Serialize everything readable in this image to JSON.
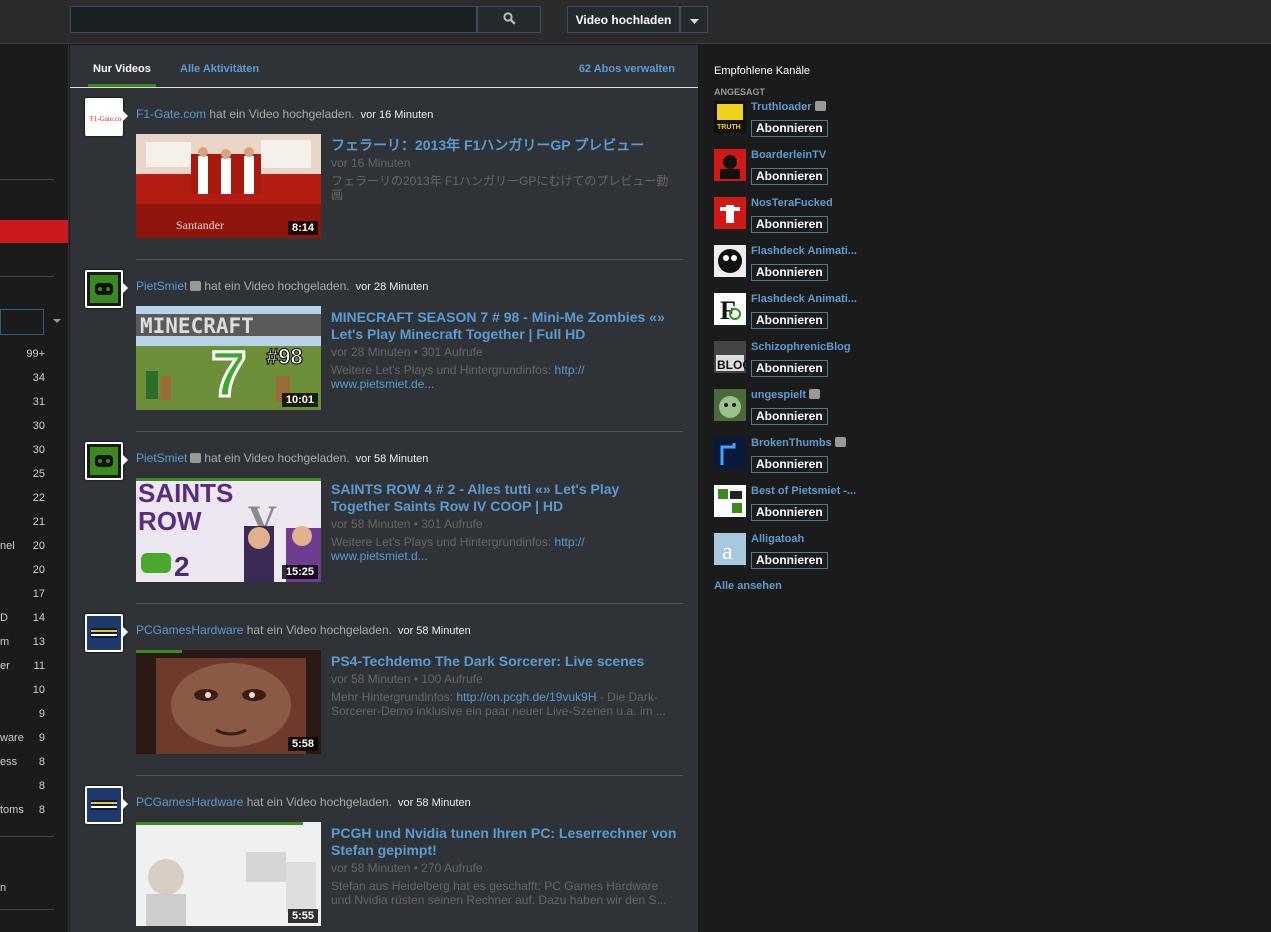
{
  "topbar": {
    "search_placeholder": "",
    "upload_label": "Video hochladen"
  },
  "sidebar": {
    "rows": [
      {
        "label": "",
        "count": "99+"
      },
      {
        "label": "",
        "count": "34"
      },
      {
        "label": "",
        "count": "31"
      },
      {
        "label": "",
        "count": "30"
      },
      {
        "label": "",
        "count": "30"
      },
      {
        "label": "",
        "count": "25"
      },
      {
        "label": "",
        "count": "22"
      },
      {
        "label": "",
        "count": "21"
      },
      {
        "label": "nel",
        "count": "20"
      },
      {
        "label": "",
        "count": "20"
      },
      {
        "label": "",
        "count": "17"
      },
      {
        "label": "D",
        "count": "14"
      },
      {
        "label": "m",
        "count": "13"
      },
      {
        "label": "er",
        "count": "11"
      },
      {
        "label": "",
        "count": "10"
      },
      {
        "label": "",
        "count": "9"
      },
      {
        "label": "ware",
        "count": "9"
      },
      {
        "label": "ess",
        "count": "8"
      },
      {
        "label": "",
        "count": "8"
      },
      {
        "label": "toms",
        "count": "8"
      }
    ],
    "bottom_text": "n"
  },
  "tabs": {
    "videos": "Nur Videos",
    "all": "Alle Aktivitäten",
    "manage": "62 Abos verwalten"
  },
  "feed": [
    {
      "channel": "F1-Gate.com",
      "verified": false,
      "action": "hat ein Video hochgeladen.",
      "ago": "vor 16 Minuten",
      "title": "フェラーリ：2013年 F1ハンガリーGP プレビュー",
      "meta": "vor 16 Minuten",
      "desc": "フェラーリの2013年 F1ハンガリーGPにむけてのプレビュー動画",
      "desc_link": "",
      "duration": "8:14"
    },
    {
      "channel": "PietSmiet",
      "verified": true,
      "action": "hat ein Video hochgeladen.",
      "ago": "vor 28 Minuten",
      "title": "MINECRAFT SEASON 7 # 98 - Mini-Me Zombies «» Let's Play Minecraft Together | Full HD",
      "meta": "vor 28 Minuten  •  301 Aufrufe",
      "desc": "Weitere Let's Plays und Hintergrundinfos: ",
      "desc_link": "http:// www.pietsmiet.de...",
      "duration": "10:01"
    },
    {
      "channel": "PietSmiet",
      "verified": true,
      "action": "hat ein Video hochgeladen.",
      "ago": "vor 58 Minuten",
      "title": "SAINTS ROW 4 # 2 - Alles tutti «» Let's Play Together Saints Row IV COOP | HD",
      "meta": "vor 58 Minuten  •  301 Aufrufe",
      "desc": "Weitere Let's Plays und Hintergrundinfos: ",
      "desc_link": "http:// www.pietsmiet.d...",
      "duration": "15:25"
    },
    {
      "channel": "PCGamesHardware",
      "verified": false,
      "action": "hat ein Video hochgeladen.",
      "ago": "vor 58 Minuten",
      "title": "PS4-Techdemo The Dark Sorcerer: Live scenes",
      "meta": "vor 58 Minuten  •  100 Aufrufe",
      "desc": "Mehr Hintergrundinfos: ",
      "desc_link": "http://on.pcgh.de/19vuk9H",
      "desc_after": " - Die Dark-Sorcerer-Demo inklusive ein paar neuer Live-Szenen u.a. im ...",
      "duration": "5:58"
    },
    {
      "channel": "PCGamesHardware",
      "verified": false,
      "action": "hat ein Video hochgeladen.",
      "ago": "vor 58 Minuten",
      "title": "PCGH und Nvidia tunen Ihren PC: Leserrechner von Stefan gepimpt!",
      "meta": "vor 58 Minuten  •  270 Aufrufe",
      "desc": "Stefan aus Heidelberg hat es geschafft: PC Games Hardware und Nvidia rüsten seinen Rechner auf. Dazu haben wir den S...",
      "desc_link": "",
      "duration": "5:55"
    }
  ],
  "recommended": {
    "title": "Empfohlene Kanäle",
    "label": "ANGESAGT",
    "subscribe_label": "Abonnieren",
    "channels": [
      {
        "name": "Truthloader",
        "verified": true
      },
      {
        "name": "BoarderleinTV",
        "verified": false
      },
      {
        "name": "NosTeraFucked",
        "verified": false
      },
      {
        "name": "Flashdeck Animati...",
        "verified": false
      },
      {
        "name": "Flashdeck Animati...",
        "verified": false
      },
      {
        "name": "SchizophrenicBlog",
        "verified": false
      },
      {
        "name": "ungespielt",
        "verified": true
      },
      {
        "name": "BrokenThumbs",
        "verified": true
      },
      {
        "name": "Best of Pietsmiet -...",
        "verified": false
      },
      {
        "name": "Alligatoah",
        "verified": false
      }
    ],
    "see_all": "Alle ansehen"
  }
}
